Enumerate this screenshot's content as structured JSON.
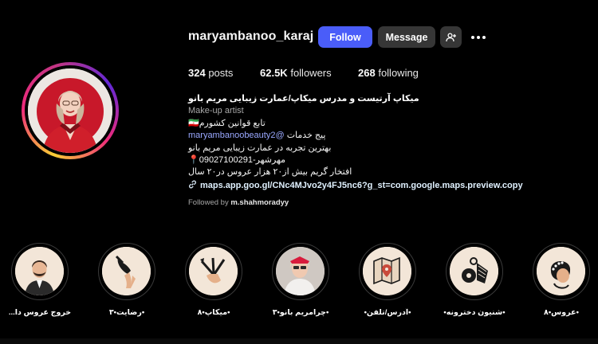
{
  "profile": {
    "username": "maryambanoo_karaj",
    "follow_label": "Follow",
    "message_label": "Message",
    "add_user_icon": "person-add-icon",
    "more_icon": "more-horizontal-icon"
  },
  "stats": {
    "posts_count": "324",
    "posts_label": "posts",
    "followers_count": "62.5K",
    "followers_label": "followers",
    "following_count": "268",
    "following_label": "following"
  },
  "bio": {
    "name": "میکاپ آرتیست و مدرس میکاپ/عمارت زیبایی مریم بانو",
    "category": "Make-up artist",
    "line1": "تابع قوانین کشورم🇮🇷",
    "line2_prefix": "پیج خدمات ",
    "line2_mention": "@maryambanoobeauty2",
    "line3": "بهترین تجربه در عمارت زیبایی مریم بانو",
    "line4": "مهرشهر-09027100291📍",
    "line5": "افتخار گریم بیش از۲۰ هزار عروس در۲۰ سال",
    "link": "maps.app.goo.gl/CNc4MJvo2y4FJ5nc6?g_st=com.google.maps.preview.copy",
    "link_icon": "link-icon"
  },
  "followed_by": {
    "prefix": "Followed by ",
    "user": "m.shahmoradyy"
  },
  "highlights": [
    {
      "label": "خروج عروس دا...",
      "icon": "groom-portrait-icon"
    },
    {
      "label": "•رضایت•۳",
      "icon": "telephone-hand-icon"
    },
    {
      "label": "•میکاپ•۸",
      "icon": "makeup-brushes-icon"
    },
    {
      "label": "•چرامریم بانو•۳",
      "icon": "bride-photo-icon"
    },
    {
      "label": "•آدرس/تلفن•",
      "icon": "map-pin-icon"
    },
    {
      "label": "•شنیون دخترونه•",
      "icon": "hair-accessories-icon"
    },
    {
      "label": "•عروس•۸",
      "icon": "bridal-hairstyle-icon"
    }
  ],
  "colors": {
    "background": "#000000",
    "follow_button": "#4a5df9",
    "secondary_button": "#363636",
    "mention": "#9aa8ff",
    "highlight_bg": "#f3e6d8"
  }
}
